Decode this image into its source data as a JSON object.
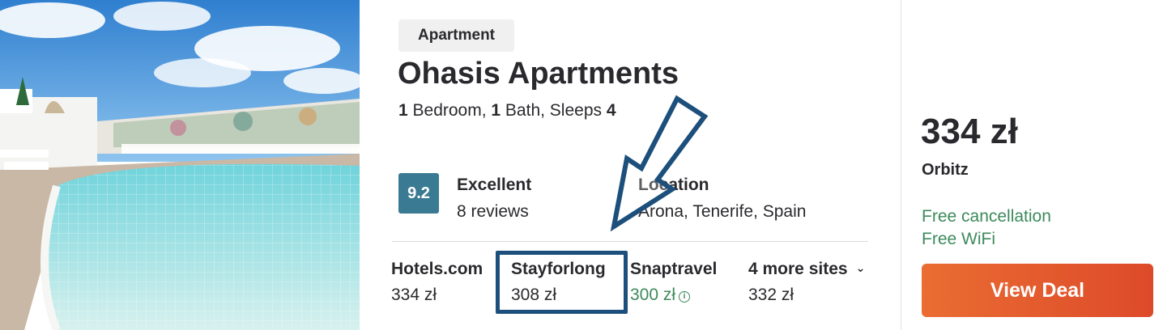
{
  "listing": {
    "type": "Apartment",
    "name": "Ohasis Apartments",
    "facts": {
      "bedrooms": "1",
      "bedroom_label": " Bedroom, ",
      "baths": "1",
      "bath_label": " Bath, Sleeps ",
      "sleeps": "4"
    },
    "rating": {
      "score": "9.2",
      "label": "Excellent",
      "reviews": "8 reviews"
    },
    "location": {
      "label": "Location",
      "value": "Arona, Tenerife, Spain"
    }
  },
  "sites": [
    {
      "name": "Hotels.com",
      "price": "334 zł"
    },
    {
      "name": "Stayforlong",
      "price": "308 zł"
    },
    {
      "name": "Snaptravel",
      "price": "300 zł"
    },
    {
      "name": "4 more sites",
      "price": "332 zł"
    }
  ],
  "deal": {
    "price": "334 zł",
    "provider": "Orbitz",
    "perks": [
      "Free cancellation",
      "Free WiFi"
    ],
    "button_label": "View Deal"
  },
  "icons": {
    "info": "info-icon",
    "expand": "chevron-down-icon"
  },
  "colors": {
    "score_bg": "#3a7a93",
    "perk_green": "#3d8a5c",
    "cta_orange": "#e45a2e",
    "annotation_blue": "#1c4f7b"
  }
}
